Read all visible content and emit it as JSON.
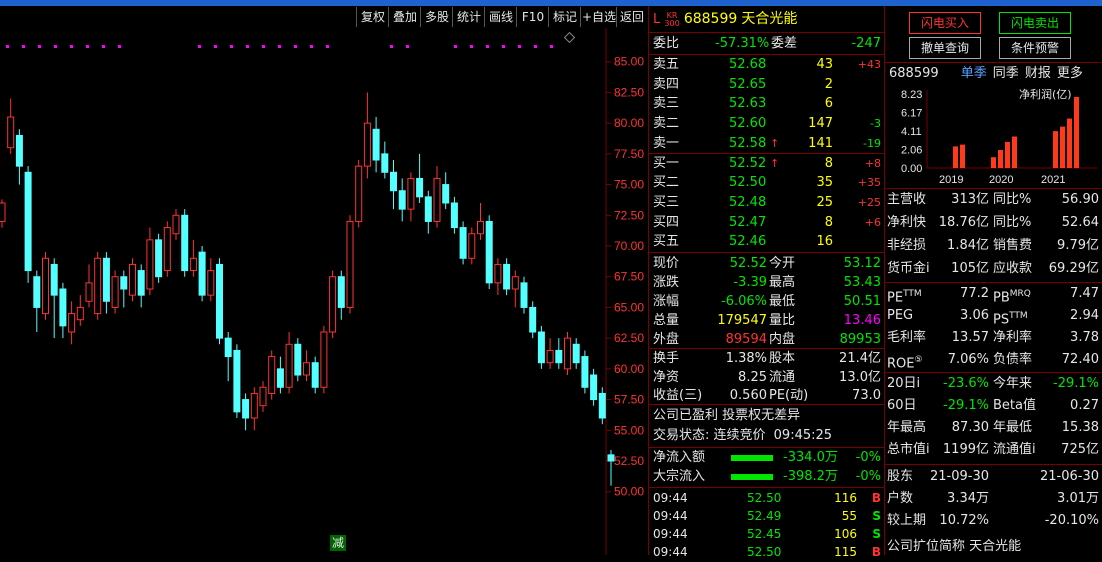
{
  "toolbar": {
    "items": [
      "复权",
      "叠加",
      "多股",
      "统计",
      "画线",
      "F10",
      "标记",
      "+自选",
      "返回"
    ]
  },
  "chart": {
    "price_ticks": [
      "85.00",
      "82.50",
      "80.00",
      "77.50",
      "75.00",
      "72.50",
      "70.00",
      "67.50",
      "65.00",
      "62.50",
      "60.00",
      "57.50",
      "55.00",
      "52.50",
      "50.00"
    ],
    "reduce_label": "减"
  },
  "chart_data": {
    "type": "candlestick",
    "ylim": [
      49.0,
      87.5
    ],
    "candles": [
      {
        "o": 72.0,
        "c": 73.5,
        "h": 73.8,
        "l": 71.5
      },
      {
        "o": 78.0,
        "c": 80.5,
        "h": 82.0,
        "l": 77.5
      },
      {
        "o": 79.0,
        "c": 76.5,
        "h": 79.5,
        "l": 75.0
      },
      {
        "o": 76.0,
        "c": 68.0,
        "h": 76.5,
        "l": 67.0
      },
      {
        "o": 67.5,
        "c": 65.0,
        "h": 68.0,
        "l": 63.0
      },
      {
        "o": 64.5,
        "c": 69.0,
        "h": 69.5,
        "l": 64.0
      },
      {
        "o": 68.5,
        "c": 66.0,
        "h": 69.0,
        "l": 62.5
      },
      {
        "o": 66.5,
        "c": 63.5,
        "h": 67.0,
        "l": 62.5
      },
      {
        "o": 63.0,
        "c": 64.5,
        "h": 65.5,
        "l": 62.0
      },
      {
        "o": 64.0,
        "c": 65.0,
        "h": 66.0,
        "l": 63.5
      },
      {
        "o": 65.5,
        "c": 67.0,
        "h": 68.5,
        "l": 65.0
      },
      {
        "o": 64.5,
        "c": 69.0,
        "h": 69.5,
        "l": 64.0
      },
      {
        "o": 69.0,
        "c": 65.5,
        "h": 69.5,
        "l": 64.5
      },
      {
        "o": 65.0,
        "c": 67.5,
        "h": 68.0,
        "l": 64.5
      },
      {
        "o": 67.5,
        "c": 66.5,
        "h": 68.0,
        "l": 65.0
      },
      {
        "o": 66.0,
        "c": 68.5,
        "h": 69.0,
        "l": 65.5
      },
      {
        "o": 68.0,
        "c": 66.0,
        "h": 68.5,
        "l": 65.0
      },
      {
        "o": 66.5,
        "c": 70.5,
        "h": 71.5,
        "l": 66.0
      },
      {
        "o": 70.5,
        "c": 67.5,
        "h": 71.0,
        "l": 67.0
      },
      {
        "o": 68.0,
        "c": 71.5,
        "h": 72.0,
        "l": 67.5
      },
      {
        "o": 71.0,
        "c": 72.5,
        "h": 73.0,
        "l": 70.5
      },
      {
        "o": 72.5,
        "c": 68.0,
        "h": 73.0,
        "l": 67.5
      },
      {
        "o": 68.0,
        "c": 69.0,
        "h": 70.5,
        "l": 67.5
      },
      {
        "o": 69.5,
        "c": 66.0,
        "h": 70.0,
        "l": 65.5
      },
      {
        "o": 66.0,
        "c": 68.0,
        "h": 69.0,
        "l": 65.5
      },
      {
        "o": 68.5,
        "c": 62.5,
        "h": 69.0,
        "l": 62.0
      },
      {
        "o": 62.5,
        "c": 61.0,
        "h": 63.0,
        "l": 59.0
      },
      {
        "o": 61.5,
        "c": 56.5,
        "h": 62.0,
        "l": 56.0
      },
      {
        "o": 57.5,
        "c": 56.0,
        "h": 58.0,
        "l": 55.0
      },
      {
        "o": 56.0,
        "c": 58.0,
        "h": 58.5,
        "l": 55.0
      },
      {
        "o": 57.0,
        "c": 58.5,
        "h": 59.0,
        "l": 56.5
      },
      {
        "o": 58.0,
        "c": 61.0,
        "h": 61.5,
        "l": 57.5
      },
      {
        "o": 60.0,
        "c": 58.5,
        "h": 61.0,
        "l": 58.0
      },
      {
        "o": 58.5,
        "c": 62.0,
        "h": 63.0,
        "l": 58.0
      },
      {
        "o": 62.0,
        "c": 59.5,
        "h": 62.5,
        "l": 59.0
      },
      {
        "o": 59.5,
        "c": 60.5,
        "h": 61.5,
        "l": 59.0
      },
      {
        "o": 60.5,
        "c": 58.5,
        "h": 61.0,
        "l": 58.0
      },
      {
        "o": 58.5,
        "c": 63.0,
        "h": 63.5,
        "l": 58.0
      },
      {
        "o": 63.0,
        "c": 67.5,
        "h": 68.0,
        "l": 62.5
      },
      {
        "o": 67.5,
        "c": 65.0,
        "h": 68.0,
        "l": 64.0
      },
      {
        "o": 65.0,
        "c": 72.0,
        "h": 72.5,
        "l": 64.5
      },
      {
        "o": 72.0,
        "c": 76.5,
        "h": 77.0,
        "l": 71.5
      },
      {
        "o": 76.5,
        "c": 80.0,
        "h": 82.5,
        "l": 75.5
      },
      {
        "o": 79.5,
        "c": 77.0,
        "h": 80.5,
        "l": 76.0
      },
      {
        "o": 77.5,
        "c": 76.0,
        "h": 78.5,
        "l": 75.5
      },
      {
        "o": 76.0,
        "c": 74.5,
        "h": 77.0,
        "l": 73.0
      },
      {
        "o": 74.5,
        "c": 73.0,
        "h": 75.5,
        "l": 72.0
      },
      {
        "o": 73.0,
        "c": 75.5,
        "h": 76.0,
        "l": 72.0
      },
      {
        "o": 75.5,
        "c": 74.0,
        "h": 77.5,
        "l": 73.5
      },
      {
        "o": 74.0,
        "c": 72.0,
        "h": 74.5,
        "l": 71.0
      },
      {
        "o": 72.0,
        "c": 75.5,
        "h": 76.5,
        "l": 71.5
      },
      {
        "o": 75.0,
        "c": 73.5,
        "h": 76.0,
        "l": 73.0
      },
      {
        "o": 73.5,
        "c": 71.5,
        "h": 74.0,
        "l": 71.0
      },
      {
        "o": 71.5,
        "c": 69.0,
        "h": 72.0,
        "l": 68.5
      },
      {
        "o": 69.0,
        "c": 71.0,
        "h": 71.5,
        "l": 68.5
      },
      {
        "o": 71.0,
        "c": 72.0,
        "h": 73.5,
        "l": 70.5
      },
      {
        "o": 72.0,
        "c": 67.0,
        "h": 72.5,
        "l": 66.5
      },
      {
        "o": 67.0,
        "c": 68.5,
        "h": 69.0,
        "l": 66.0
      },
      {
        "o": 68.5,
        "c": 66.5,
        "h": 69.0,
        "l": 66.0
      },
      {
        "o": 66.5,
        "c": 67.5,
        "h": 68.0,
        "l": 65.0
      },
      {
        "o": 67.0,
        "c": 65.0,
        "h": 67.5,
        "l": 64.5
      },
      {
        "o": 65.0,
        "c": 63.0,
        "h": 65.5,
        "l": 62.5
      },
      {
        "o": 63.0,
        "c": 60.5,
        "h": 63.5,
        "l": 60.0
      },
      {
        "o": 60.5,
        "c": 61.5,
        "h": 62.5,
        "l": 60.0
      },
      {
        "o": 61.5,
        "c": 60.5,
        "h": 62.5,
        "l": 60.0
      },
      {
        "o": 60.0,
        "c": 62.5,
        "h": 63.0,
        "l": 59.5
      },
      {
        "o": 62.0,
        "c": 60.5,
        "h": 62.5,
        "l": 60.0
      },
      {
        "o": 61.0,
        "c": 58.5,
        "h": 61.5,
        "l": 58.0
      },
      {
        "o": 59.5,
        "c": 57.5,
        "h": 60.0,
        "l": 57.0
      },
      {
        "o": 58.0,
        "c": 56.0,
        "h": 58.5,
        "l": 55.5
      },
      {
        "o": 53.0,
        "c": 52.5,
        "h": 53.4,
        "l": 50.5
      }
    ]
  },
  "quote": {
    "badge_top": "KR",
    "badge_bottom": "300",
    "prefix": "L",
    "code": "688599",
    "name": "天合光能",
    "weibi_label": "委比",
    "weibi_value": "-57.31%",
    "weicha_label": "委差",
    "weicha_value": "-247",
    "sell": [
      {
        "label": "卖五",
        "price": "52.68",
        "vol": "43",
        "chg": "+43"
      },
      {
        "label": "卖四",
        "price": "52.65",
        "vol": "2",
        "chg": ""
      },
      {
        "label": "卖三",
        "price": "52.63",
        "vol": "6",
        "chg": ""
      },
      {
        "label": "卖二",
        "price": "52.60",
        "vol": "147",
        "chg": "-3"
      },
      {
        "label": "卖一",
        "price": "52.58",
        "vol": "141",
        "chg": "-19"
      }
    ],
    "buy": [
      {
        "label": "买一",
        "price": "52.52",
        "vol": "8",
        "chg": "+8"
      },
      {
        "label": "买二",
        "price": "52.50",
        "vol": "35",
        "chg": "+35"
      },
      {
        "label": "买三",
        "price": "52.48",
        "price_color": "green",
        "vol": "25",
        "chg": "+25"
      },
      {
        "label": "买四",
        "price": "52.47",
        "vol": "8",
        "chg": "+6"
      },
      {
        "label": "买五",
        "price": "52.46",
        "vol": "16",
        "chg": ""
      }
    ],
    "stats": [
      {
        "l1": "现价",
        "v1": "52.52",
        "c1": "green",
        "l2": "今开",
        "v2": "53.12",
        "c2": "green"
      },
      {
        "l1": "涨跌",
        "v1": "-3.39",
        "c1": "green",
        "l2": "最高",
        "v2": "53.43",
        "c2": "green"
      },
      {
        "l1": "涨幅",
        "v1": "-6.06%",
        "c1": "green",
        "l2": "最低",
        "v2": "50.51",
        "c2": "green"
      },
      {
        "l1": "总量",
        "v1": "179547",
        "c1": "yellow",
        "l2": "量比",
        "v2": "13.46",
        "c2": "magenta"
      },
      {
        "l1": "外盘",
        "v1": "89594",
        "c1": "red",
        "l2": "内盘",
        "v2": "89953",
        "c2": "green"
      }
    ],
    "stats2": [
      {
        "l1": "换手",
        "v1": "1.38%",
        "l2": "股本",
        "v2": "21.4亿"
      },
      {
        "l1": "净资",
        "v1": "8.25",
        "l2": "流通",
        "v2": "13.0亿"
      },
      {
        "l1": "收益(三)",
        "v1": "0.560",
        "l2": "PE(动)",
        "v2": "73.0"
      }
    ],
    "note1": "公司已盈利 投票权无差异",
    "note2_label": "交易状态: 连续竞价",
    "note2_time": "09:45:25",
    "flows": [
      {
        "label": "净流入额",
        "value": "-334.0万",
        "pct": "-0%"
      },
      {
        "label": "大宗流入",
        "value": "-398.2万",
        "pct": "-0%"
      }
    ],
    "ticks": [
      {
        "time": "09:44",
        "price": "52.50",
        "vol": "116",
        "side": "B"
      },
      {
        "time": "09:44",
        "price": "52.49",
        "vol": "55",
        "side": "S"
      },
      {
        "time": "09:44",
        "price": "52.45",
        "vol": "106",
        "side": "S"
      },
      {
        "time": "09:44",
        "price": "52.50",
        "vol": "115",
        "side": "B"
      }
    ]
  },
  "right": {
    "buttons": [
      {
        "label": "闪电买入",
        "color": "#ff3232"
      },
      {
        "label": "闪电卖出",
        "color": "#00e600"
      },
      {
        "label": "撤单查询",
        "color": "#e6e6e6"
      },
      {
        "label": "条件预警",
        "color": "#e6e6e6"
      }
    ],
    "fin_code": "688599",
    "fin_tabs": [
      "单季",
      "同季",
      "财报",
      "更多"
    ],
    "fin_chart_label": "净利润(亿)",
    "fin_y": [
      "8.23",
      "6.17",
      "4.11",
      "2.06",
      "0.00"
    ],
    "fin_years": [
      "2019",
      "2020",
      "2021"
    ],
    "fin_chart_data": {
      "type": "bar",
      "series": [
        {
          "values": [
            2.4,
            2.6
          ]
        },
        {
          "values": [
            1.2,
            2.0,
            2.9,
            3.5
          ]
        },
        {
          "values": [
            4.1,
            4.6,
            5.5,
            7.9
          ]
        }
      ]
    },
    "fin_rows": [
      {
        "l1": "主营收",
        "v1": "313亿",
        "l2": "同比%",
        "v2": "56.90"
      },
      {
        "l1": "净利快",
        "v1": "18.76亿",
        "l2": "同比%",
        "v2": "52.64"
      },
      {
        "l1": "非经损",
        "v1": "1.84亿",
        "l2": "销售费",
        "v2": "9.79亿"
      },
      {
        "l1": "货币金i",
        "v1": "105亿",
        "l2": "应收款",
        "v2": "69.29亿"
      }
    ],
    "val_rows": [
      {
        "l1": "PE",
        "s1": "TTM",
        "v1": "77.2",
        "l2": "PB",
        "s2": "MRQ",
        "v2": "7.47"
      },
      {
        "l1": "PEG",
        "s1": "",
        "v1": "3.06",
        "l2": "PS",
        "s2": "TTM",
        "v2": "2.94"
      },
      {
        "l1": "毛利率",
        "s1": "",
        "v1": "13.57",
        "l2": "净利率",
        "s2": "",
        "v2": "3.78"
      },
      {
        "l1": "ROE",
        "s1": "⑤",
        "v1": "7.06%",
        "l2": "负债率",
        "s2": "",
        "v2": "72.40"
      }
    ],
    "perf_rows": [
      {
        "l1": "20日i",
        "v1": "-23.6%",
        "c1": "green",
        "l2": "今年来",
        "v2": "-29.1%",
        "c2": "green"
      },
      {
        "l1": "60日",
        "v1": "-29.1%",
        "c1": "green",
        "l2": "Beta值",
        "v2": "0.27",
        "c2": "white"
      },
      {
        "l1": "年最高",
        "v1": "87.30",
        "c1": "white",
        "l2": "年最低",
        "v2": "15.38",
        "c2": "white"
      },
      {
        "l1": "总市值i",
        "v1": "1199亿",
        "c1": "white",
        "l2": "流通值i",
        "v2": "725亿",
        "c2": "white"
      }
    ],
    "holder_rows": [
      {
        "l1": "股东",
        "v1": "21-09-30",
        "l2": "",
        "v2": "21-06-30"
      },
      {
        "l1": "户数",
        "v1": "3.34万",
        "l2": "",
        "v2": "3.01万"
      },
      {
        "l1": "较上期",
        "v1": "10.72%",
        "l2": "",
        "v2": "-20.10%"
      }
    ],
    "footer": "公司扩位简称 天合光能"
  }
}
